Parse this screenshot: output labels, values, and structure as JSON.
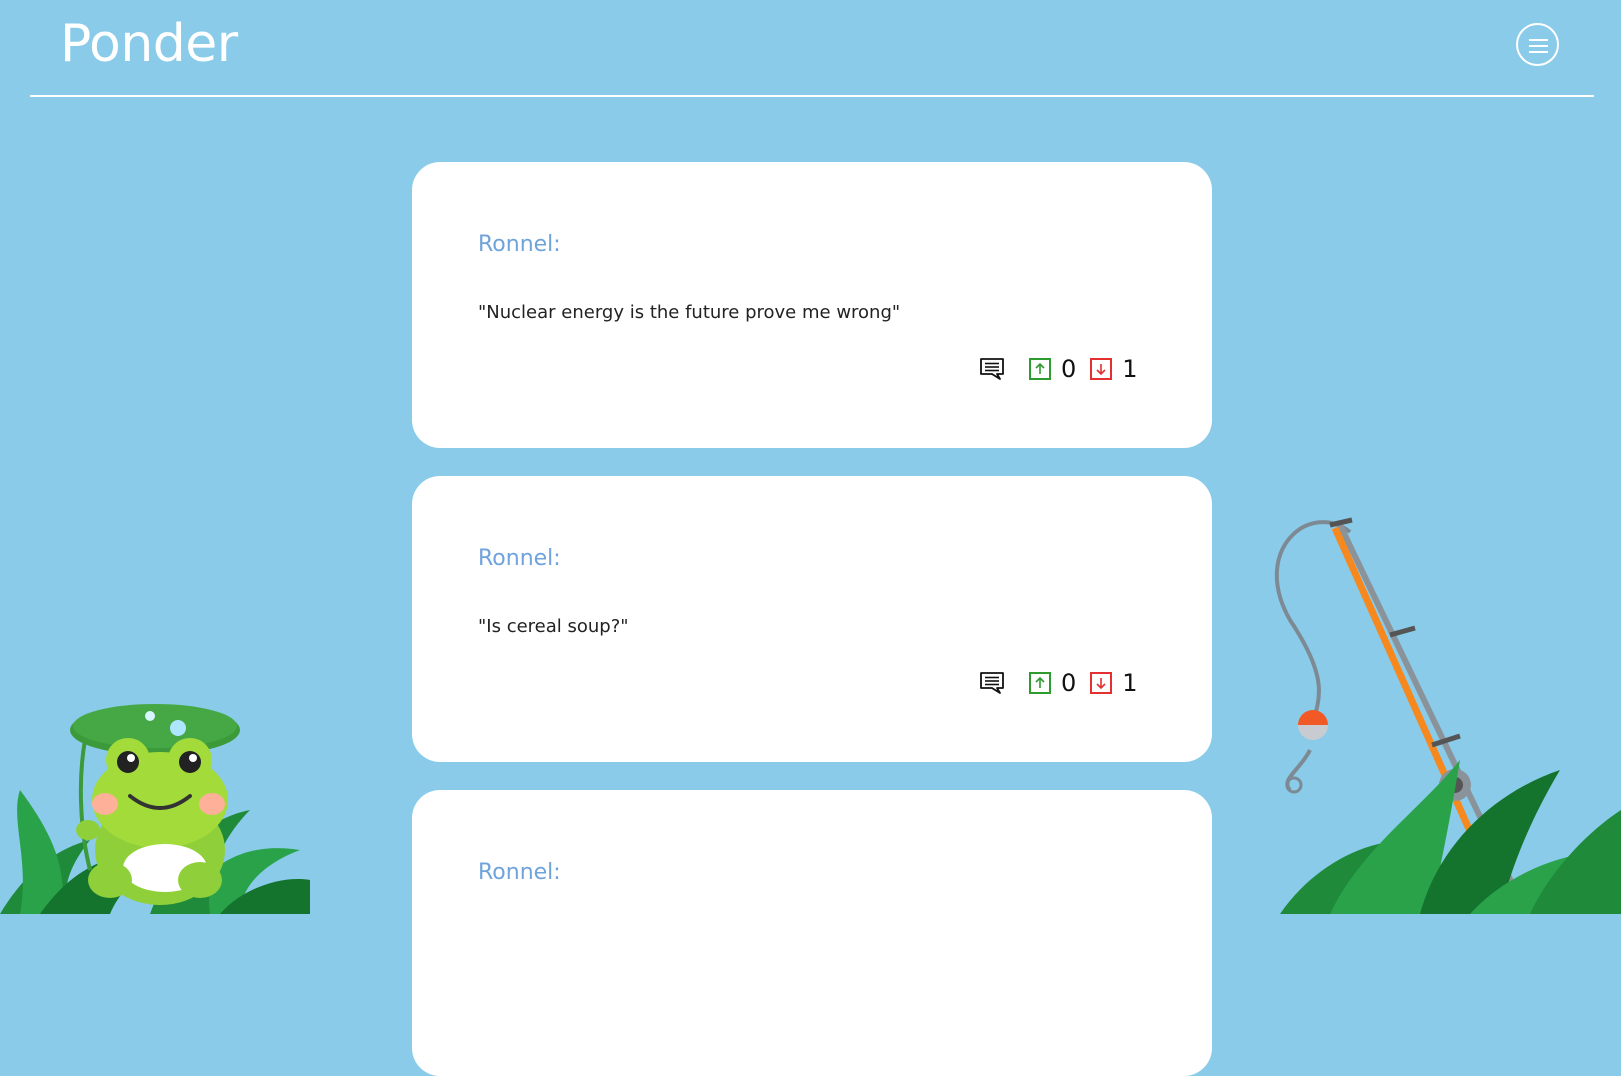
{
  "app": {
    "logo_text": "Ponder"
  },
  "header": {
    "menu_icon": "hamburger-menu-icon"
  },
  "posts": [
    {
      "author": "Ronnel:",
      "text": "\"Nuclear energy is the future prove me wrong\"",
      "upvotes": "0",
      "downvotes": "1"
    },
    {
      "author": "Ronnel:",
      "text": "\"Is cereal soup?\"",
      "upvotes": "0",
      "downvotes": "1"
    },
    {
      "author": "Ronnel:",
      "text": ""
    }
  ],
  "icons": {
    "comment": "comment-icon",
    "upvote": "arrow-up-icon",
    "downvote": "arrow-down-icon"
  },
  "colors": {
    "background": "#89cbe9",
    "card": "#ffffff",
    "author": "#6fa3dc",
    "upvote": "#2e9b2e",
    "downvote": "#e53030"
  }
}
